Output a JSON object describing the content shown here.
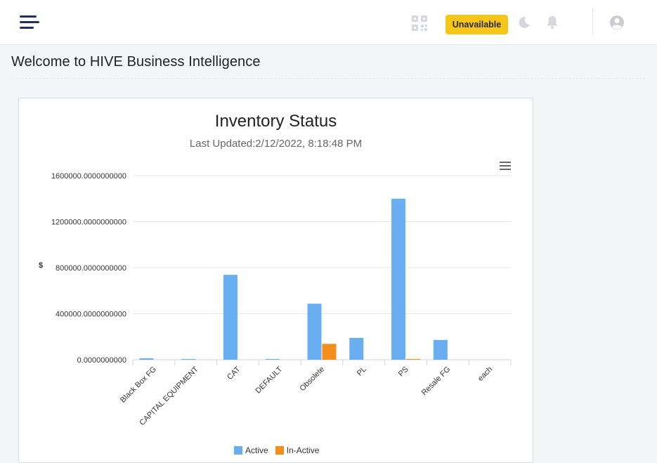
{
  "header": {
    "status_badge": "Unavailable",
    "icons": [
      "menu-icon",
      "qr-code-icon",
      "moon-icon",
      "bell-icon",
      "user-icon"
    ]
  },
  "page": {
    "title": "Welcome to HIVE Business Intelligence"
  },
  "chart_data": {
    "type": "bar",
    "title": "Inventory Status",
    "subtitle": "Last Updated:2/12/2022, 8:18:48 PM",
    "xlabel": "",
    "ylabel": "$",
    "ylim": [
      0,
      1600000
    ],
    "yticks": [
      0,
      400000,
      800000,
      1200000,
      1600000
    ],
    "ytick_labels": [
      "0.0000000000",
      "400000.0000000000",
      "800000.0000000000",
      "1200000.0000000000",
      "1600000.0000000000"
    ],
    "categories": [
      "Black Box FG",
      "CAPITAL EQUIPMENT",
      "CAT",
      "DEFAULT",
      "Obsolete",
      "PL",
      "PS",
      "Resale FG",
      "each"
    ],
    "series": [
      {
        "name": "Active",
        "color": "#6aaef2",
        "values": [
          12000,
          6000,
          738000,
          2000,
          487000,
          190000,
          1400000,
          172000,
          0
        ]
      },
      {
        "name": "In-Active",
        "color": "#f28e1c",
        "values": [
          0,
          0,
          0,
          0,
          138000,
          0,
          3000,
          0,
          0
        ]
      }
    ],
    "grid": true,
    "legend": "bottom-center"
  }
}
